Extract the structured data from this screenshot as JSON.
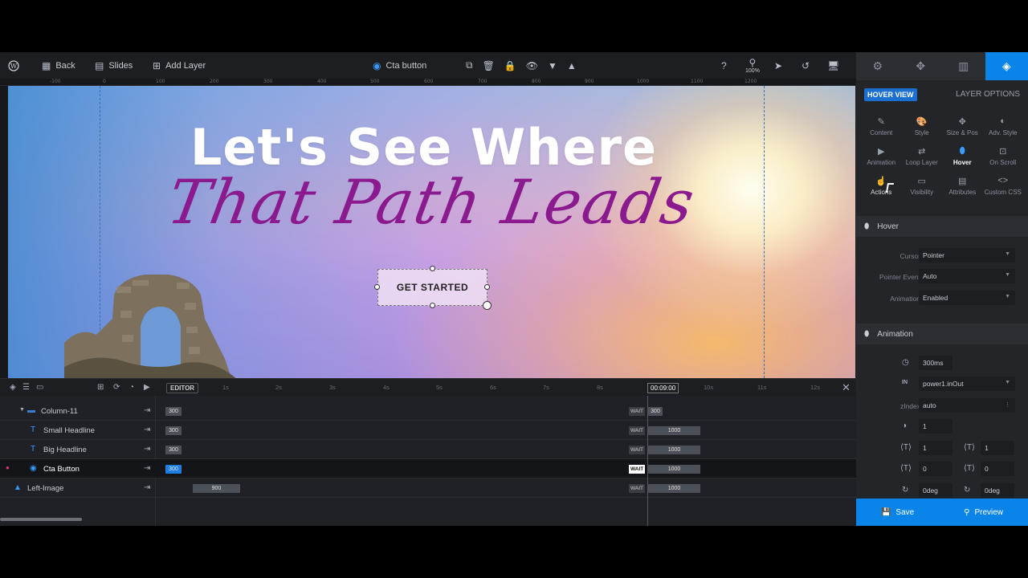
{
  "topbar": {
    "back": "Back",
    "slides": "Slides",
    "add_layer": "Add Layer",
    "layer_name": "Cta button",
    "zoom": "100%"
  },
  "ruler": [
    "-100",
    "0",
    "100",
    "200",
    "300",
    "400",
    "500",
    "600",
    "700",
    "800",
    "900",
    "1000",
    "1100",
    "1200"
  ],
  "canvas": {
    "headline": "Let's See Where",
    "script_headline": "That Path Leads",
    "cta_label": "GET STARTED"
  },
  "right_panel": {
    "hover_view": "HOVER VIEW",
    "layer_options": "LAYER OPTIONS",
    "options": [
      {
        "label": "Content",
        "icon": "pencil-icon"
      },
      {
        "label": "Style",
        "icon": "palette-icon"
      },
      {
        "label": "Size & Pos",
        "icon": "move-icon"
      },
      {
        "label": "Adv. Style",
        "icon": "contrast-icon"
      },
      {
        "label": "Animation",
        "icon": "play-icon"
      },
      {
        "label": "Loop Layer",
        "icon": "loop-icon"
      },
      {
        "label": "Hover",
        "icon": "mouse-icon"
      },
      {
        "label": "On Scroll",
        "icon": "scroll-icon"
      },
      {
        "label": "Actions",
        "icon": "actions-icon"
      },
      {
        "label": "Visibility",
        "icon": "visibility-icon"
      },
      {
        "label": "Attributes",
        "icon": "document-icon"
      },
      {
        "label": "Custom CSS",
        "icon": "code-icon"
      }
    ],
    "hover_section": "Hover",
    "cursor_label": "Cursor",
    "cursor_value": "Pointer",
    "pointer_event_label": "Pointer Event",
    "pointer_event_value": "Auto",
    "animation_label": "Animation",
    "animation_value": "Enabled",
    "animation_section": "Animation",
    "duration": "300ms",
    "easing_tag": "IN",
    "easing": "power1.inOut",
    "zindex_label": "zIndex",
    "zindex_value": "auto",
    "opacity": "1",
    "scale_x": "1",
    "scale_y": "1",
    "skew_x": "0",
    "skew_y": "0",
    "rot_x": "0deg",
    "rot_y": "0deg",
    "save": "Save",
    "preview": "Preview"
  },
  "timeline": {
    "editor": "EDITOR",
    "time": "00:09:00",
    "ticks": [
      "1s",
      "2s",
      "3s",
      "4s",
      "5s",
      "6s",
      "7s",
      "8s",
      "10s",
      "11s",
      "12s"
    ],
    "rows": [
      {
        "name": "Column-11",
        "start": "300",
        "wait": "WAIT",
        "end": "300"
      },
      {
        "name": "Small Headline",
        "start": "300",
        "wait": "WAIT",
        "end": "1000"
      },
      {
        "name": "Big Headline",
        "start": "300",
        "wait": "WAIT",
        "end": "1000"
      },
      {
        "name": "Cta Button",
        "start": "300",
        "wait": "WAIT",
        "end": "1000"
      },
      {
        "name": "Left-Image",
        "start": "900",
        "wait": "WAIT",
        "end": "1000"
      }
    ]
  }
}
